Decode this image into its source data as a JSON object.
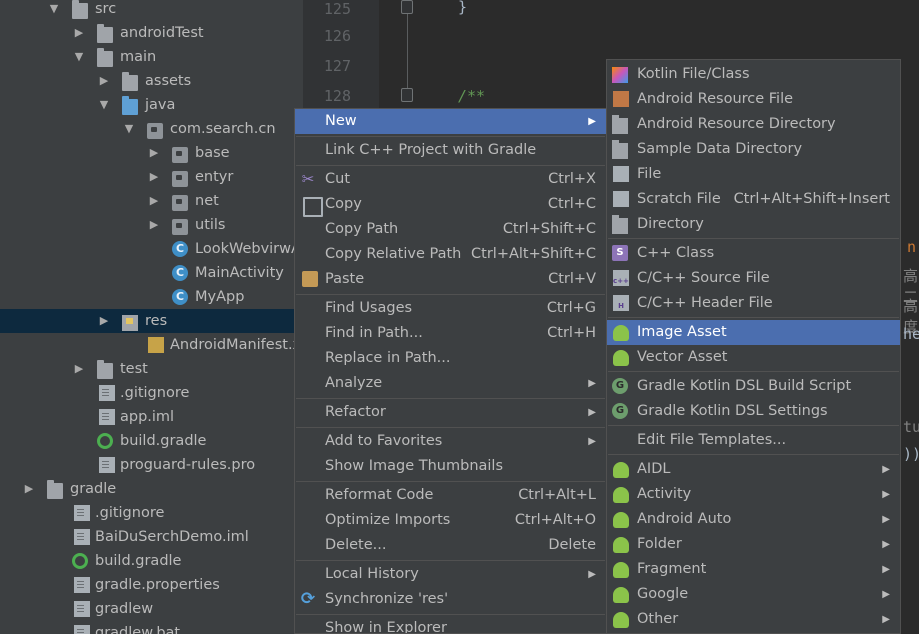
{
  "tree": [
    {
      "label": "src",
      "depth": 0,
      "arrow": "down",
      "icon": "folder-icon"
    },
    {
      "label": "androidTest",
      "depth": 1,
      "arrow": "right",
      "icon": "folder-icon"
    },
    {
      "label": "main",
      "depth": 1,
      "arrow": "down",
      "icon": "folder-icon"
    },
    {
      "label": "assets",
      "depth": 2,
      "arrow": "right",
      "icon": "folder-icon"
    },
    {
      "label": "java",
      "depth": 2,
      "arrow": "down",
      "icon": "source-folder-icon"
    },
    {
      "label": "com.search.cn",
      "depth": 3,
      "arrow": "down",
      "icon": "package-icon"
    },
    {
      "label": "base",
      "depth": 4,
      "arrow": "right",
      "icon": "package-icon"
    },
    {
      "label": "entyr",
      "depth": 4,
      "arrow": "right",
      "icon": "package-icon"
    },
    {
      "label": "net",
      "depth": 4,
      "arrow": "right",
      "icon": "package-icon"
    },
    {
      "label": "utils",
      "depth": 4,
      "arrow": "right",
      "icon": "package-icon"
    },
    {
      "label": "LookWebvirwActivity",
      "depth": 4,
      "arrow": "",
      "icon": "class-icon"
    },
    {
      "label": "MainActivity",
      "depth": 4,
      "arrow": "",
      "icon": "class-icon"
    },
    {
      "label": "MyApp",
      "depth": 4,
      "arrow": "",
      "icon": "class-icon"
    },
    {
      "label": "res",
      "depth": 2,
      "arrow": "right",
      "icon": "resource-folder-icon",
      "selected": true
    },
    {
      "label": "AndroidManifest.xml",
      "depth": 3,
      "arrow": "",
      "icon": "xml-file-icon"
    },
    {
      "label": "test",
      "depth": 1,
      "arrow": "right",
      "icon": "folder-icon"
    },
    {
      "label": ".gitignore",
      "depth": 1,
      "arrow": "",
      "icon": "file-icon"
    },
    {
      "label": "app.iml",
      "depth": 1,
      "arrow": "",
      "icon": "file-icon"
    },
    {
      "label": "build.gradle",
      "depth": 1,
      "arrow": "",
      "icon": "gradle-icon"
    },
    {
      "label": "proguard-rules.pro",
      "depth": 1,
      "arrow": "",
      "icon": "file-icon"
    },
    {
      "label": "gradle",
      "depth": -1,
      "arrow": "right",
      "icon": "folder-icon"
    },
    {
      "label": ".gitignore",
      "depth": 0,
      "arrow": "",
      "icon": "file-icon"
    },
    {
      "label": "BaiDuSerchDemo.iml",
      "depth": 0,
      "arrow": "",
      "icon": "file-icon"
    },
    {
      "label": "build.gradle",
      "depth": 0,
      "arrow": "",
      "icon": "gradle-icon"
    },
    {
      "label": "gradle.properties",
      "depth": 0,
      "arrow": "",
      "icon": "file-icon"
    },
    {
      "label": "gradlew",
      "depth": 0,
      "arrow": "",
      "icon": "file-icon"
    },
    {
      "label": "gradlew.bat",
      "depth": 0,
      "arrow": "",
      "icon": "file-icon"
    }
  ],
  "editor": {
    "line_numbers": [
      "125",
      "126",
      "127",
      "128"
    ],
    "code_brace": "}",
    "code_doc": "/**",
    "right_fragments": [
      "n",
      "高二",
      "高度",
      "he",
      "tu",
      "))"
    ]
  },
  "context_menu": {
    "new": "New",
    "link_cpp": "Link C++ Project with Gradle",
    "cut": "Cut",
    "cut_sc": "Ctrl+X",
    "copy": "Copy",
    "copy_sc": "Ctrl+C",
    "copy_path": "Copy Path",
    "copy_path_sc": "Ctrl+Shift+C",
    "copy_rel": "Copy Relative Path",
    "copy_rel_sc": "Ctrl+Alt+Shift+C",
    "paste": "Paste",
    "paste_sc": "Ctrl+V",
    "find_usages": "Find Usages",
    "find_usages_sc": "Ctrl+G",
    "find_in_path": "Find in Path...",
    "find_in_path_sc": "Ctrl+H",
    "replace_in_path": "Replace in Path...",
    "analyze": "Analyze",
    "refactor": "Refactor",
    "add_fav": "Add to Favorites",
    "show_thumbs": "Show Image Thumbnails",
    "reformat": "Reformat Code",
    "reformat_sc": "Ctrl+Alt+L",
    "optimize": "Optimize Imports",
    "optimize_sc": "Ctrl+Alt+O",
    "delete": "Delete...",
    "delete_sc": "Delete",
    "local_history": "Local History",
    "synchronize": "Synchronize 'res'",
    "show_explorer": "Show in Explorer"
  },
  "submenu": {
    "kotlin": "Kotlin File/Class",
    "android_res_file": "Android Resource File",
    "android_res_dir": "Android Resource Directory",
    "sample_data": "Sample Data Directory",
    "file": "File",
    "scratch": "Scratch File",
    "scratch_sc": "Ctrl+Alt+Shift+Insert",
    "directory": "Directory",
    "cpp_class": "C++ Class",
    "cpp_source": "C/C++ Source File",
    "cpp_header": "C/C++ Header File",
    "image_asset": "Image Asset",
    "vector_asset": "Vector Asset",
    "gradle_build_script": "Gradle Kotlin DSL Build Script",
    "gradle_settings": "Gradle Kotlin DSL Settings",
    "edit_templates": "Edit File Templates...",
    "aidl": "AIDL",
    "activity": "Activity",
    "android_auto": "Android Auto",
    "folder": "Folder",
    "fragment": "Fragment",
    "google": "Google",
    "other": "Other"
  },
  "colors": {
    "highlight": "#4b6eaf",
    "tree_selected": "#0d293e",
    "menu_bg": "#3c3f41"
  }
}
